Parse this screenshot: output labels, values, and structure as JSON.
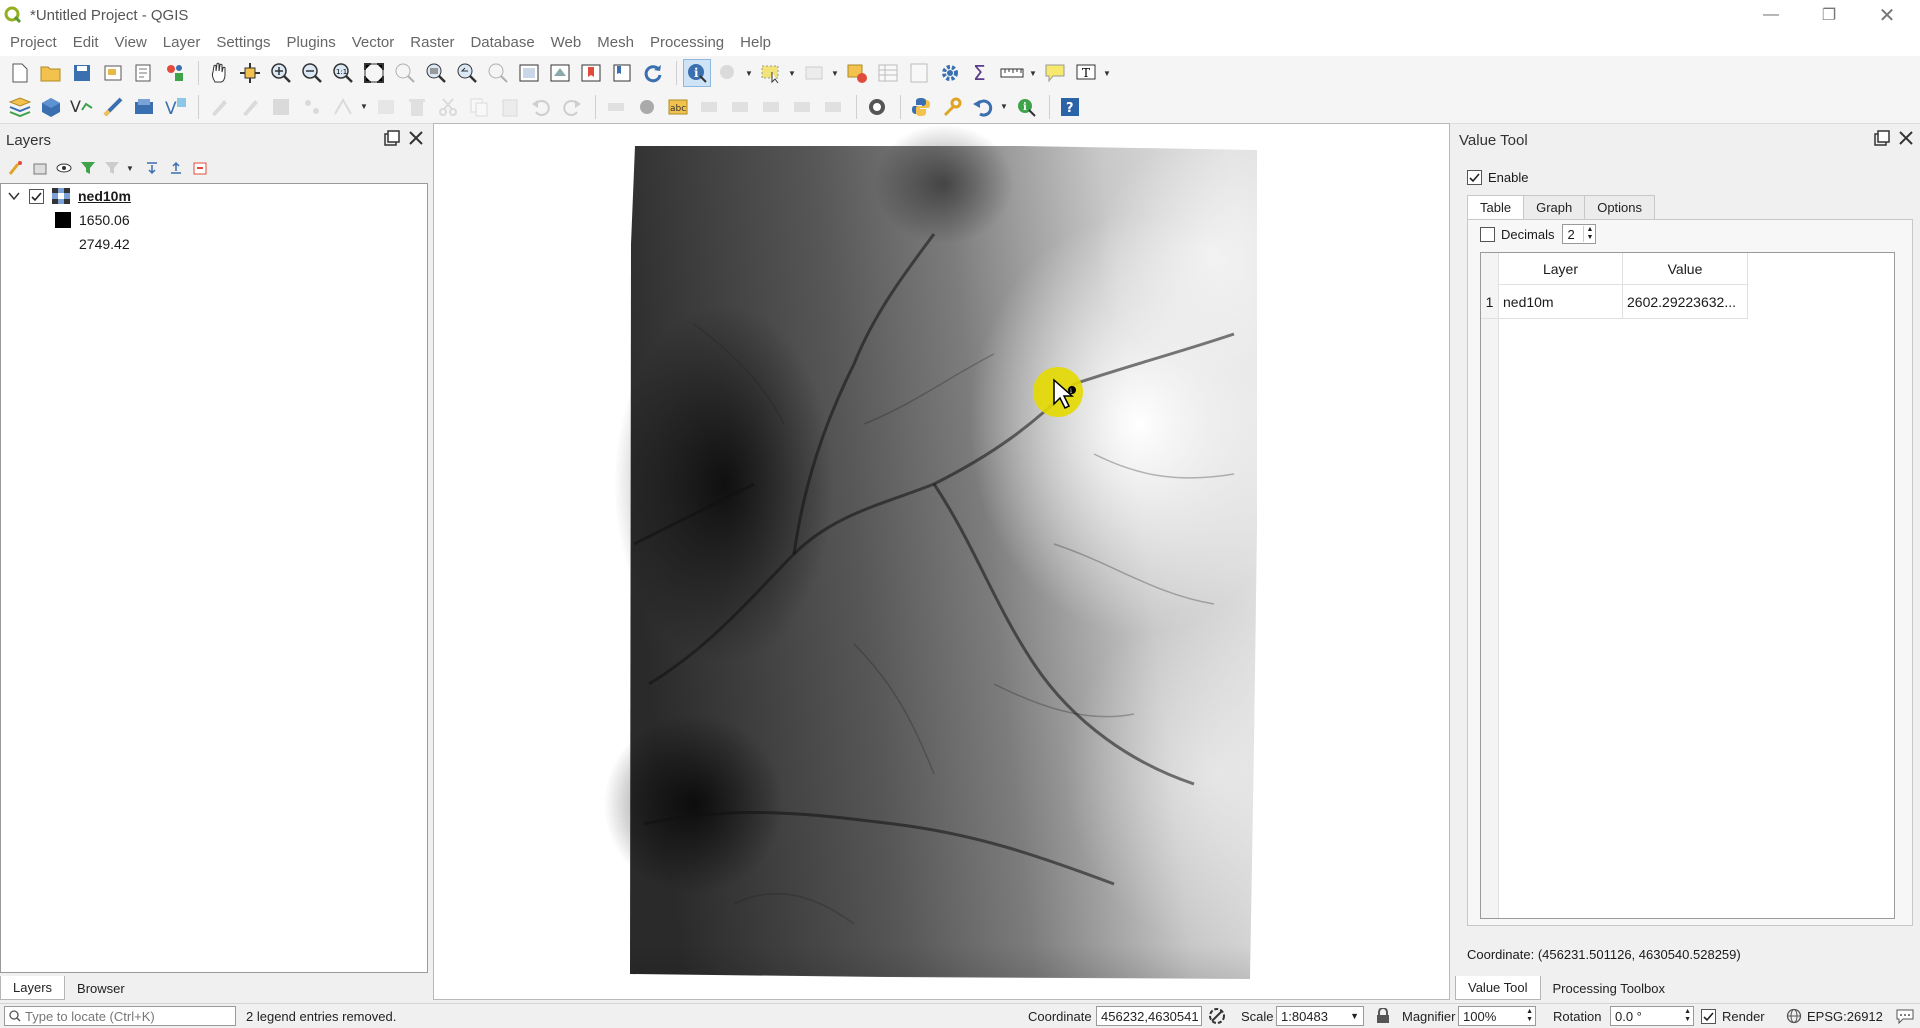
{
  "window": {
    "title": "*Untitled Project - QGIS",
    "minimize_icon": "minimize-icon",
    "maximize_icon": "restore-icon",
    "close_icon": "close-icon"
  },
  "menu": [
    "Project",
    "Edit",
    "View",
    "Layer",
    "Settings",
    "Plugins",
    "Vector",
    "Raster",
    "Database",
    "Web",
    "Mesh",
    "Processing",
    "Help"
  ],
  "layers_panel": {
    "title": "Layers",
    "layer": {
      "name": "ned10m",
      "checked": true,
      "legend_min": "1650.06",
      "legend_max": "2749.42"
    },
    "tabs": [
      "Layers",
      "Browser"
    ],
    "selected_tab": "Layers"
  },
  "value_tool": {
    "title": "Value Tool",
    "enable_label": "Enable",
    "enable_checked": true,
    "tabs": [
      "Table",
      "Graph",
      "Options"
    ],
    "selected_tab": "Table",
    "decimals_label": "Decimals",
    "decimals_checked": false,
    "decimals_value": "2",
    "table": {
      "headers": [
        "Layer",
        "Value"
      ],
      "rows": [
        {
          "index": "1",
          "layer": "ned10m",
          "value": "2602.29223632..."
        }
      ]
    },
    "coordinate_text": "Coordinate: (456231.501126, 4630540.528259)",
    "bottom_tabs": [
      "Value Tool",
      "Processing Toolbox"
    ],
    "selected_bottom_tab": "Value Tool"
  },
  "statusbar": {
    "locator_placeholder": "Type to locate (Ctrl+K)",
    "message": "2 legend entries removed.",
    "coordinate_label": "Coordinate",
    "coordinate_value": "456232,4630541",
    "scale_label": "Scale",
    "scale_value": "1:80483",
    "magnifier_label": "Magnifier",
    "magnifier_value": "100%",
    "rotation_label": "Rotation",
    "rotation_value": "0.0 °",
    "render_label": "Render",
    "render_checked": true,
    "crs": "EPSG:26912"
  },
  "colors": {
    "accent": "#589632",
    "cursor_highlight": "#e6d900",
    "raster_low": "#000000",
    "raster_high": "#ffffff"
  }
}
